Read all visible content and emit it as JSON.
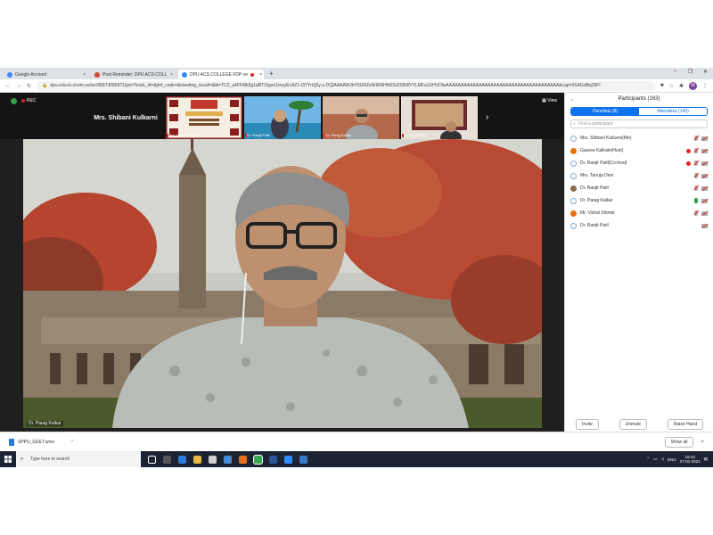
{
  "browser": {
    "tabs": [
      {
        "title": "Google Account",
        "favicon_color": "#4285f4",
        "active": false
      },
      {
        "title": "Post Reminder: DPU ACS COLL",
        "favicon_color": "#d44638",
        "active": false
      },
      {
        "title": "DPU ACS COLLEGE FDP on",
        "favicon_color": "#2d8cff",
        "active": true
      }
    ],
    "new_tab": "+",
    "url": "dpu-edu-in.zoom.us/wc/96873689971/join?track_id=&jmf_code=&meeting_result=&tk=TC2_a4FFMk5g1aBT/Ugvn1mzyEcAZ1-t37YrUj5y-u.DQIAAAAWJhY6URZeWIRNHhRSUIS6WVYLMFa1UHVDlwAAAAAAAAAAAAAAAAAAAAAAAAAAAAAAAAAAAAAA&cap=0SAGdBq29Fl",
    "avatar_letter": "M"
  },
  "zoom": {
    "rec_label": "REC",
    "active_name": "Mrs. Shibani Kulkarni",
    "thumbnails": [
      {
        "label": "Mrs. Gauri Kalhale"
      },
      {
        "label": "Dr. Ranjit Patil"
      },
      {
        "label": "Dr. Parag Kalkar"
      },
      {
        "label": "Dr. Ranjit Patil"
      }
    ],
    "next_arrow": "›",
    "view_label": "View",
    "speaker_label": "Dr. Parag Kalkar"
  },
  "participants": {
    "title": "Participants (163)",
    "collapse_icon": "⌄",
    "tab_panelists": "Panelists (8)",
    "tab_attendees": "Attendees (145)",
    "search_placeholder": "Find a participant",
    "rows": [
      {
        "name": "Mrs. Shibani Kulkarni(Me)",
        "avatar": "ring",
        "raised": false,
        "mic": "muted",
        "cam_off": true
      },
      {
        "name": "Gauree Kalhale(Host)",
        "avatar": "orange",
        "raised": true,
        "mic": "muted",
        "cam_off": true
      },
      {
        "name": "Dr. Ranjit Patil(Co-host)",
        "avatar": "ring",
        "raised": true,
        "mic": "muted",
        "cam_off": true
      },
      {
        "name": "Mrs. Tanuja Devi",
        "avatar": "ring",
        "raised": false,
        "mic": "muted",
        "cam_off": true
      },
      {
        "name": "Dr. Ranjit Patil",
        "avatar": "photo",
        "raised": false,
        "mic": "muted",
        "cam_off": true
      },
      {
        "name": "Dr. Parag Kalkar",
        "avatar": "ring",
        "raised": false,
        "mic": "live",
        "cam_off": true
      },
      {
        "name": "Mr. Vishal Shinde",
        "avatar": "orange",
        "raised": false,
        "mic": "muted",
        "cam_off": true
      },
      {
        "name": "Dr. Ranjit Patil",
        "avatar": "ring",
        "raised": false,
        "mic": "none",
        "cam_off": true
      }
    ],
    "invite": "Invite",
    "unmute": "Unmute",
    "raise_hand": "Raise Hand"
  },
  "downloads": {
    "file": "SPPU_GEET.wmv",
    "show_all": "Show all",
    "close": "×"
  },
  "taskbar": {
    "search_placeholder": "Type here to search",
    "time": "19:43",
    "date": "27-01-2021",
    "lang": "ENG"
  }
}
